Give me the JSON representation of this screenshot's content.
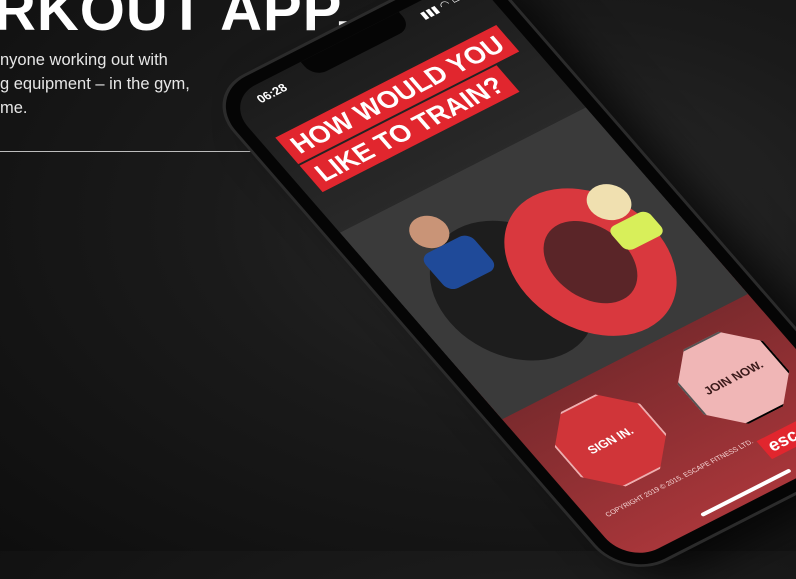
{
  "promo": {
    "headline": "RKOUT APP.",
    "description_lines": [
      "nyone working out with",
      "g equipment – in the gym,",
      "me."
    ]
  },
  "phone": {
    "status_time": "06:28",
    "status_icons": "signal-icon wifi-icon battery-icon",
    "question_lines": [
      "HOW WOULD YOU",
      "LIKE TO TRAIN?"
    ],
    "sign_in_label": "SIGN IN.",
    "join_now_label": "JOIN NOW.",
    "copyright": "COPYRIGHT 2019 © 2015. ESCAPE FITNESS LTD.",
    "logo_text": "escape"
  },
  "colors": {
    "accent_red": "#e1262e",
    "join_button": "#f0b6b6",
    "sign_in_button": "#d03539"
  }
}
